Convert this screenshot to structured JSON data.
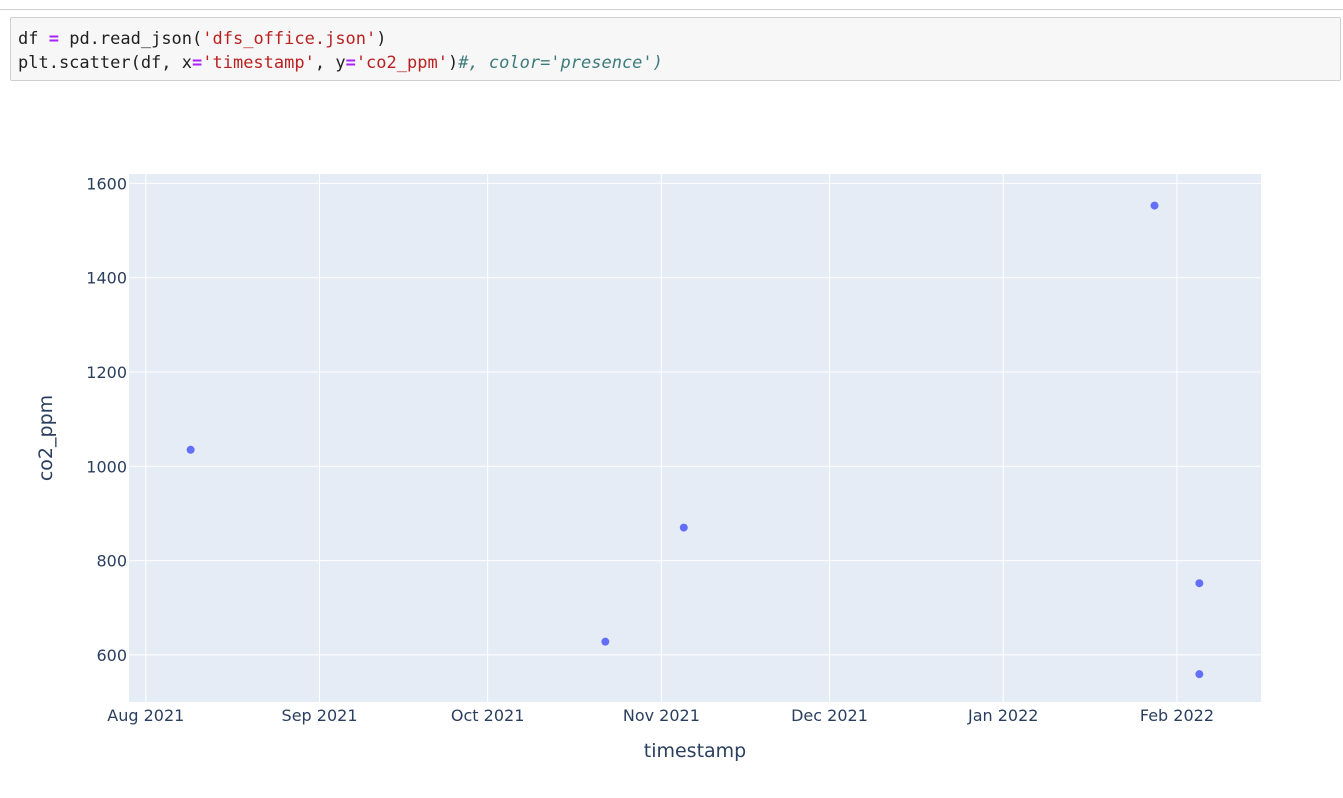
{
  "code_cell": {
    "line1": {
      "a": "df ",
      "b": "=",
      "c": " pd.read_json(",
      "d": "'dfs_office.json'",
      "e": ")"
    },
    "line2": {
      "a": "plt.scatter(df, x",
      "b": "=",
      "c": "'timestamp'",
      "d": ", y",
      "e": "=",
      "f": "'co2_ppm'",
      "g": ")",
      "h": "#, color='presence')"
    }
  },
  "colors": {
    "plot_bg": "#e5ecf6",
    "grid": "#ffffff",
    "marker": "#636efa",
    "axis_text": "#2a3f5f"
  },
  "chart_data": {
    "type": "scatter",
    "title": "",
    "xlabel": "timestamp",
    "ylabel": "co2_ppm",
    "x_axis_type": "date",
    "xlim": [
      "2021-07-29",
      "2022-02-16"
    ],
    "ylim": [
      500,
      1620
    ],
    "x_ticks": [
      {
        "date": "2021-08-01",
        "label": "Aug 2021"
      },
      {
        "date": "2021-09-01",
        "label": "Sep 2021"
      },
      {
        "date": "2021-10-01",
        "label": "Oct 2021"
      },
      {
        "date": "2021-11-01",
        "label": "Nov 2021"
      },
      {
        "date": "2021-12-01",
        "label": "Dec 2021"
      },
      {
        "date": "2022-01-01",
        "label": "Jan 2022"
      },
      {
        "date": "2022-02-01",
        "label": "Feb 2022"
      }
    ],
    "y_ticks": [
      600,
      800,
      1000,
      1200,
      1400,
      1600
    ],
    "grid": true,
    "points": [
      {
        "x": "2021-08-09",
        "y": 1035
      },
      {
        "x": "2021-10-22",
        "y": 628
      },
      {
        "x": "2021-11-05",
        "y": 870
      },
      {
        "x": "2022-01-28",
        "y": 1553
      },
      {
        "x": "2022-02-05",
        "y": 752
      },
      {
        "x": "2022-02-05",
        "y": 559
      }
    ]
  }
}
